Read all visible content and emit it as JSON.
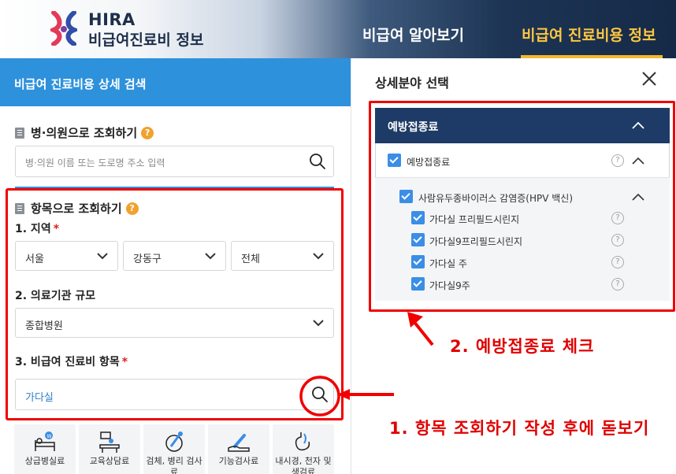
{
  "header": {
    "brand_en": "HIRA",
    "brand_ko": "비급여진료비 정보",
    "nav": [
      {
        "label": "비급여 알아보기"
      },
      {
        "label": "비급여 진료비용 정보"
      }
    ],
    "accent_color": "#f2b92f"
  },
  "left": {
    "title": "비급여 진료비용 상세 검색",
    "hospital_search": {
      "heading": "병·의원으로 조회하기",
      "help": "?",
      "placeholder": "병·의원 이름 또는 도로명 주소 입력"
    },
    "item_search": {
      "heading": "항목으로 조회하기",
      "help": "?",
      "region_label": "1. 지역",
      "required_mark": "*",
      "region_selects": [
        "서울",
        "강동구",
        "전체"
      ],
      "scale_label": "2. 의료기관 규모",
      "scale_select": "종합병원",
      "item_label": "3. 비급여 진료비 항목",
      "item_value": "가다실"
    },
    "categories": [
      {
        "label": "상급병실료",
        "icon": "bed-icon"
      },
      {
        "label": "교육상담료",
        "icon": "consult-icon"
      },
      {
        "label": "검체, 병리 검사료",
        "icon": "microscope-icon"
      },
      {
        "label": "기능검사료",
        "icon": "thermometer-icon"
      },
      {
        "label": "내시경, 천자 및 생검료",
        "icon": "endoscope-icon"
      }
    ]
  },
  "right": {
    "title": "상세분야 선택",
    "group": "예방접종료",
    "level1": "예방접종료",
    "level2": "사람유두종바이러스 감염증(HPV 백신)",
    "items": [
      "가다실 프리필드시린지",
      "가다실9프리필드시린지",
      "가다실 주",
      "가다실9주"
    ],
    "help": "?"
  },
  "annotations": {
    "note1": "1. 항목 조회하기 작성 후에 돋보기",
    "note2": "2. 예방접종료 체크",
    "color": "#e00000"
  }
}
